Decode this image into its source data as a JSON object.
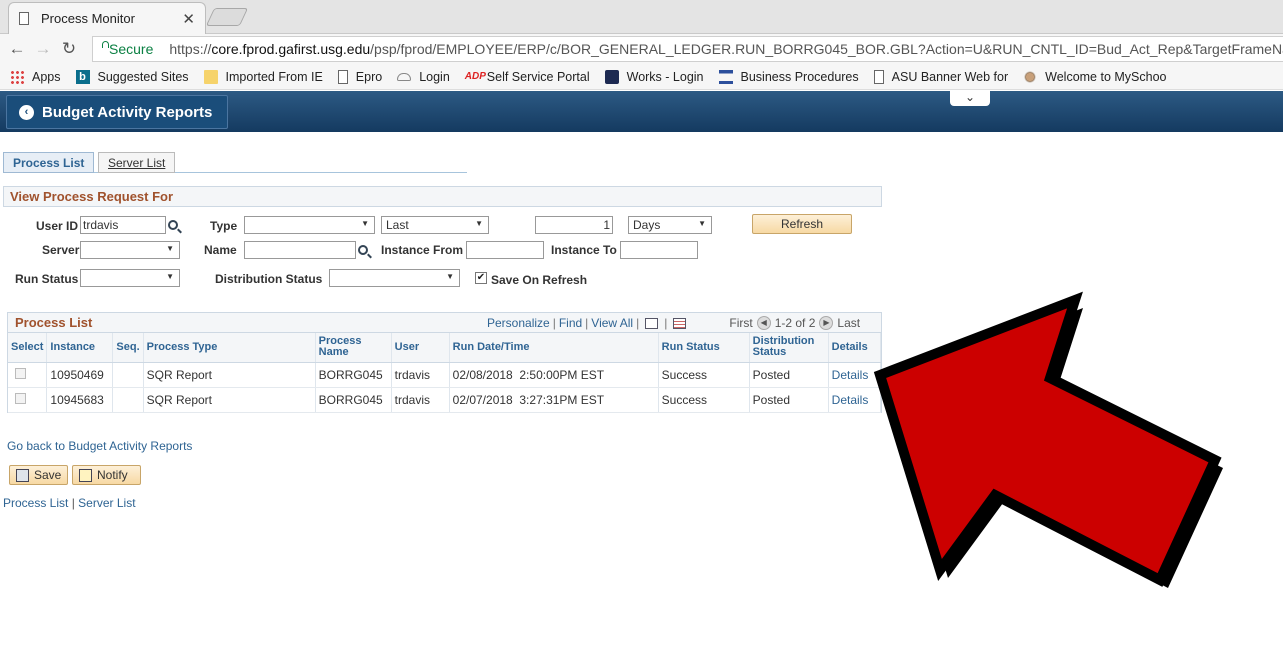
{
  "browser": {
    "tab_title": "Process Monitor",
    "close_glyph": "✕",
    "back_glyph": "←",
    "forward_glyph": "→",
    "reload_glyph": "↻",
    "secure_label": "Secure",
    "url_scheme": "https://",
    "url_host": "core.fprod.gafirst.usg.edu",
    "url_path": "/psp/fprod/EMPLOYEE/ERP/c/BOR_GENERAL_LEDGER.RUN_BORRG045_BOR.GBL?Action=U&RUN_CNTL_ID=Bud_Act_Rep&TargetFrameName=No",
    "bookmarks": [
      {
        "label": "Apps",
        "icon": "apps-icon"
      },
      {
        "label": "Suggested Sites",
        "icon": "bing-icon"
      },
      {
        "label": "Imported From IE",
        "icon": "folder-icon"
      },
      {
        "label": "Epro",
        "icon": "page-icon"
      },
      {
        "label": "Login",
        "icon": "cloud-icon"
      },
      {
        "label": "Self Service Portal",
        "icon": "adp-icon"
      },
      {
        "label": "Works - Login",
        "icon": "works-icon"
      },
      {
        "label": "Business Procedures",
        "icon": "bank-icon"
      },
      {
        "label": "ASU Banner Web for",
        "icon": "page-icon"
      },
      {
        "label": "Welcome to MySchoo",
        "icon": "myschool-icon"
      }
    ]
  },
  "header": {
    "back_label": "Budget Activity Reports",
    "back_glyph": "‹",
    "collapse_glyph": "⌄"
  },
  "tabs": [
    {
      "label": "Process List",
      "active": true
    },
    {
      "label": "Server List",
      "active": false
    }
  ],
  "request": {
    "section_title": "View Process Request For",
    "user_id_label": "User ID",
    "user_id_value": "trdavis",
    "type_label": "Type",
    "type_value": "",
    "last_value": "Last",
    "count_value": "1",
    "days_value": "Days",
    "refresh_label": "Refresh",
    "server_label": "Server",
    "server_value": "",
    "name_label": "Name",
    "name_value": "",
    "instance_from_label": "Instance From",
    "instance_from_value": "",
    "instance_to_label": "Instance To",
    "instance_to_value": "",
    "run_status_label": "Run Status",
    "run_status_value": "",
    "dist_status_label": "Distribution Status",
    "dist_status_value": "",
    "save_on_refresh_label": "Save On Refresh",
    "save_on_refresh_checked": true,
    "check_glyph": "✔"
  },
  "process_list": {
    "title": "Process List",
    "personalize": "Personalize",
    "find": "Find",
    "view_all": "View All",
    "first": "First",
    "range": "1-2 of 2",
    "last": "Last",
    "prev_glyph": "◀",
    "next_glyph": "▶",
    "columns": [
      "Select",
      "Instance",
      "Seq.",
      "Process Type",
      "Process Name",
      "User",
      "Run Date/Time",
      "Run Status",
      "Distribution Status",
      "Details"
    ],
    "rows": [
      {
        "instance": "10950469",
        "seq": "",
        "type": "SQR Report",
        "name": "BORRG045",
        "user": "trdavis",
        "run_date": "02/08/2018  2:50:00PM EST",
        "run_status": "Success",
        "dist_status": "Posted",
        "details": "Details"
      },
      {
        "instance": "10945683",
        "seq": "",
        "type": "SQR Report",
        "name": "BORRG045",
        "user": "trdavis",
        "run_date": "02/07/2018  3:27:31PM EST",
        "run_status": "Success",
        "dist_status": "Posted",
        "details": "Details"
      }
    ]
  },
  "footer": {
    "go_back": "Go back to Budget Activity Reports",
    "save": "Save",
    "notify": "Notify",
    "process_list_link": "Process List",
    "divider": "|",
    "server_list_link": "Server List"
  },
  "annotation": {
    "arrow_color": "#cc0000",
    "arrow_outline": "#000000"
  }
}
